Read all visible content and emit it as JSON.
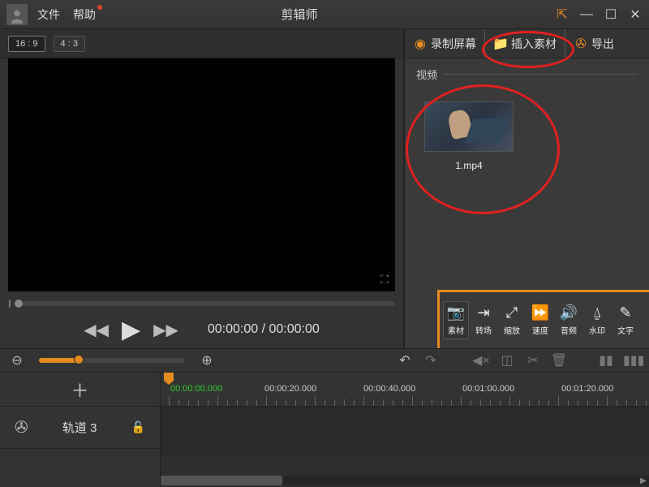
{
  "app": {
    "title": "剪辑师"
  },
  "menu": {
    "file": "文件",
    "help": "帮助"
  },
  "aspect": {
    "wide": "16 : 9",
    "standard": "4 : 3"
  },
  "playback": {
    "current": "00:00:00",
    "total": "00:00:00"
  },
  "right_actions": {
    "record": "录制屏幕",
    "import": "插入素材",
    "export": "导出"
  },
  "media": {
    "section": "视频",
    "item1": "1.mp4"
  },
  "mini": {
    "material": "素材",
    "transition": "转场",
    "scale": "缩放",
    "speed": "速度",
    "audio": "音频",
    "watermark": "水印",
    "text": "文字"
  },
  "timeline": {
    "labels": [
      "00:00:00.000",
      "00:00:20.000",
      "00:00:40.000",
      "00:01:00.000",
      "00:01:20.000"
    ],
    "track": "轨道 3",
    "add": "＋"
  }
}
